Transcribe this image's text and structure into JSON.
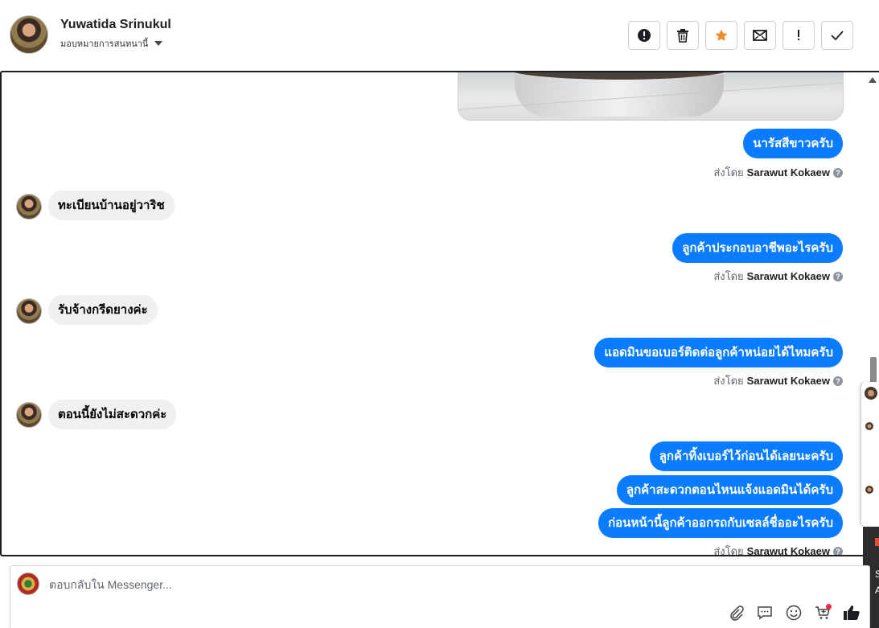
{
  "header": {
    "contact_name": "Yuwatida Srinukul",
    "assign_label": "มอบหมายการสนทนานี้",
    "actions": [
      {
        "name": "spam-button",
        "icon": "alert-circle-icon"
      },
      {
        "name": "delete-button",
        "icon": "trash-icon"
      },
      {
        "name": "star-button",
        "icon": "star-icon",
        "color": "#f28c28"
      },
      {
        "name": "mark-unread-button",
        "icon": "envelope-icon"
      },
      {
        "name": "follow-up-button",
        "icon": "exclamation-icon"
      },
      {
        "name": "done-button",
        "icon": "check-icon"
      }
    ]
  },
  "messages": [
    {
      "dir": "out",
      "text": "นารัสสีขาวครับ"
    },
    {
      "sent_by_label": "ส่งโดย",
      "sent_by_name": "Sarawut Kokaew"
    },
    {
      "dir": "in",
      "text": "ทะเบียนบ้านอยู่วาริช"
    },
    {
      "dir": "out",
      "text": "ลูกค้าประกอบอาชีพอะไรครับ"
    },
    {
      "sent_by_label": "ส่งโดย",
      "sent_by_name": "Sarawut Kokaew"
    },
    {
      "dir": "in",
      "text": "รับจ้างกรีดยางค่ะ"
    },
    {
      "dir": "out",
      "text": "แอดมินขอเบอร์ติดต่อลูกค้าหน่อยได้ไหมครับ"
    },
    {
      "sent_by_label": "ส่งโดย",
      "sent_by_name": "Sarawut Kokaew"
    },
    {
      "dir": "in",
      "text": "ตอนนี้ยังไม่สะดวกค่ะ"
    },
    {
      "dir": "out",
      "text": "ลูกค้าทิ้งเบอร์ไว้ก่อนได้เลยนะครับ"
    },
    {
      "dir": "out",
      "text": "ลูกค้าสะดวกตอนไหนแจ้งแอดมินได้ครับ"
    },
    {
      "dir": "out",
      "text": "ก่อนหน้านี้ลูกค้าออกรถกับเซลล์ชื่ออะไรครับ"
    },
    {
      "sent_by_label": "ส่งโดย",
      "sent_by_name": "Sarawut Kokaew"
    }
  ],
  "reply": {
    "placeholder": "ตอบกลับใน Messenger...",
    "tools": [
      "paperclip-icon",
      "chat-bubble-icon",
      "emoji-icon",
      "cart-icon",
      "thumbs-up-icon"
    ],
    "notification_color": "#f02849"
  },
  "side_popup": {
    "letters": [
      "S",
      "A"
    ]
  },
  "colors": {
    "outgoing_bubble": "#0a7cff",
    "incoming_bubble": "#f0f0f0",
    "text": "#050505"
  }
}
